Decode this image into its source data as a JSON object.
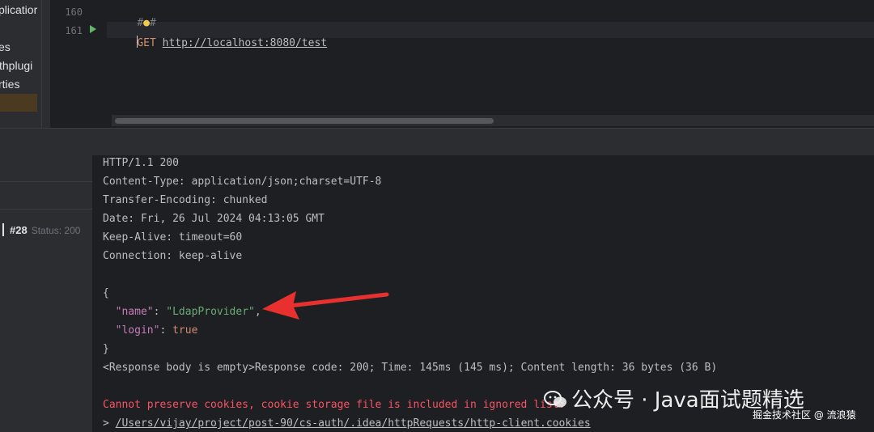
{
  "project_tree": {
    "items": [
      "plicatior",
      "es",
      "thplugi",
      "rties"
    ]
  },
  "editor": {
    "line_numbers": [
      "160",
      "161"
    ],
    "line160_hash_left": "#",
    "line160_hash_right": "#",
    "method": "GET",
    "url": "http://localhost:8080/test"
  },
  "services": {
    "request_number": "#28",
    "request_status": "Status: 200"
  },
  "response": {
    "status_line": "HTTP/1.1 200",
    "headers": [
      "Content-Type: application/json;charset=UTF-8",
      "Transfer-Encoding: chunked",
      "Date: Fri, 26 Jul 2024 04:13:05 GMT",
      "Keep-Alive: timeout=60",
      "Connection: keep-alive"
    ],
    "body_open": "{",
    "name_key": "\"name\"",
    "name_value": "\"LdapProvider\"",
    "login_key": "\"login\"",
    "login_value": "true",
    "body_close": "}",
    "summary": "<Response body is empty>Response code: 200; Time: 145ms (145 ms); Content length: 36 bytes (36 B)",
    "cookie_warning": "Cannot preserve cookies, cookie storage file is included in ignored list:",
    "cookie_prompt": ">",
    "cookie_path": "/Users/vijay/project/post-90/cs-auth/.idea/httpRequests/http-client.cookies"
  },
  "watermark": {
    "main": "公众号 · Java面试题精选",
    "sub": "掘金技术社区 @ 流浪猿"
  },
  "colors": {
    "annotation_arrow": "#e8312f",
    "json_key": "#c77dbb",
    "json_string": "#6aab73",
    "keyword": "#cf8e6d",
    "error": "#f75464"
  }
}
